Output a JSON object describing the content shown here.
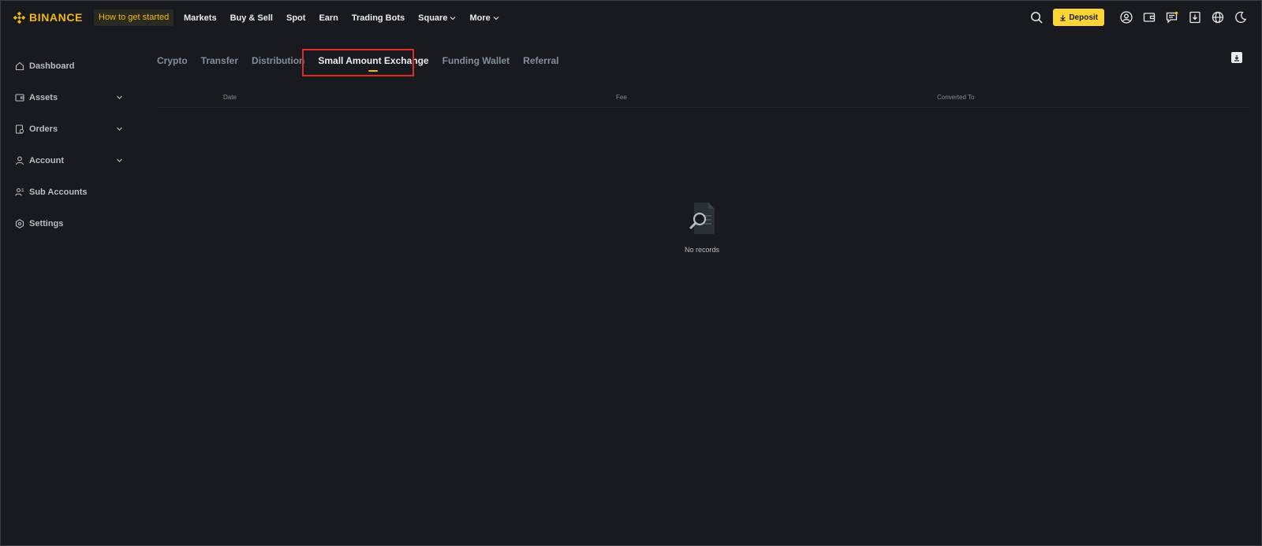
{
  "header": {
    "brand": "BINANCE",
    "cta_label": "How to get started",
    "nav": [
      {
        "label": "Markets",
        "has_dropdown": false
      },
      {
        "label": "Buy & Sell",
        "has_dropdown": false
      },
      {
        "label": "Spot",
        "has_dropdown": false
      },
      {
        "label": "Earn",
        "has_dropdown": false
      },
      {
        "label": "Trading Bots",
        "has_dropdown": false
      },
      {
        "label": "Square",
        "has_dropdown": true
      },
      {
        "label": "More",
        "has_dropdown": true
      }
    ],
    "deposit_label": "Deposit",
    "icons": [
      "search-icon",
      "user-icon",
      "wallet-icon",
      "messages-icon",
      "download-icon",
      "globe-icon",
      "moon-icon"
    ]
  },
  "sidebar": {
    "items": [
      {
        "label": "Dashboard",
        "icon": "home-icon",
        "expandable": false
      },
      {
        "label": "Assets",
        "icon": "wallet-icon",
        "expandable": true
      },
      {
        "label": "Orders",
        "icon": "orders-icon",
        "expandable": true
      },
      {
        "label": "Account",
        "icon": "person-icon",
        "expandable": true
      },
      {
        "label": "Sub Accounts",
        "icon": "group-icon",
        "expandable": false
      },
      {
        "label": "Settings",
        "icon": "settings-icon",
        "expandable": false
      }
    ]
  },
  "tabs": {
    "items": [
      {
        "label": "Crypto"
      },
      {
        "label": "Transfer"
      },
      {
        "label": "Distribution"
      },
      {
        "label": "Small Amount Exchange"
      },
      {
        "label": "Funding Wallet"
      },
      {
        "label": "Referral"
      }
    ],
    "active": "Small Amount Exchange"
  },
  "table": {
    "columns": [
      "Date",
      "Fee",
      "Converted To"
    ],
    "rows": []
  },
  "empty_state": {
    "label": "No records",
    "icon": "no-records-icon"
  },
  "colors": {
    "background": "#181a20",
    "accent": "#f0b90b",
    "deposit_button": "#fcd535",
    "highlight_box": "#e02d24",
    "text_primary": "#eaecef",
    "text_secondary": "#848e9c"
  }
}
